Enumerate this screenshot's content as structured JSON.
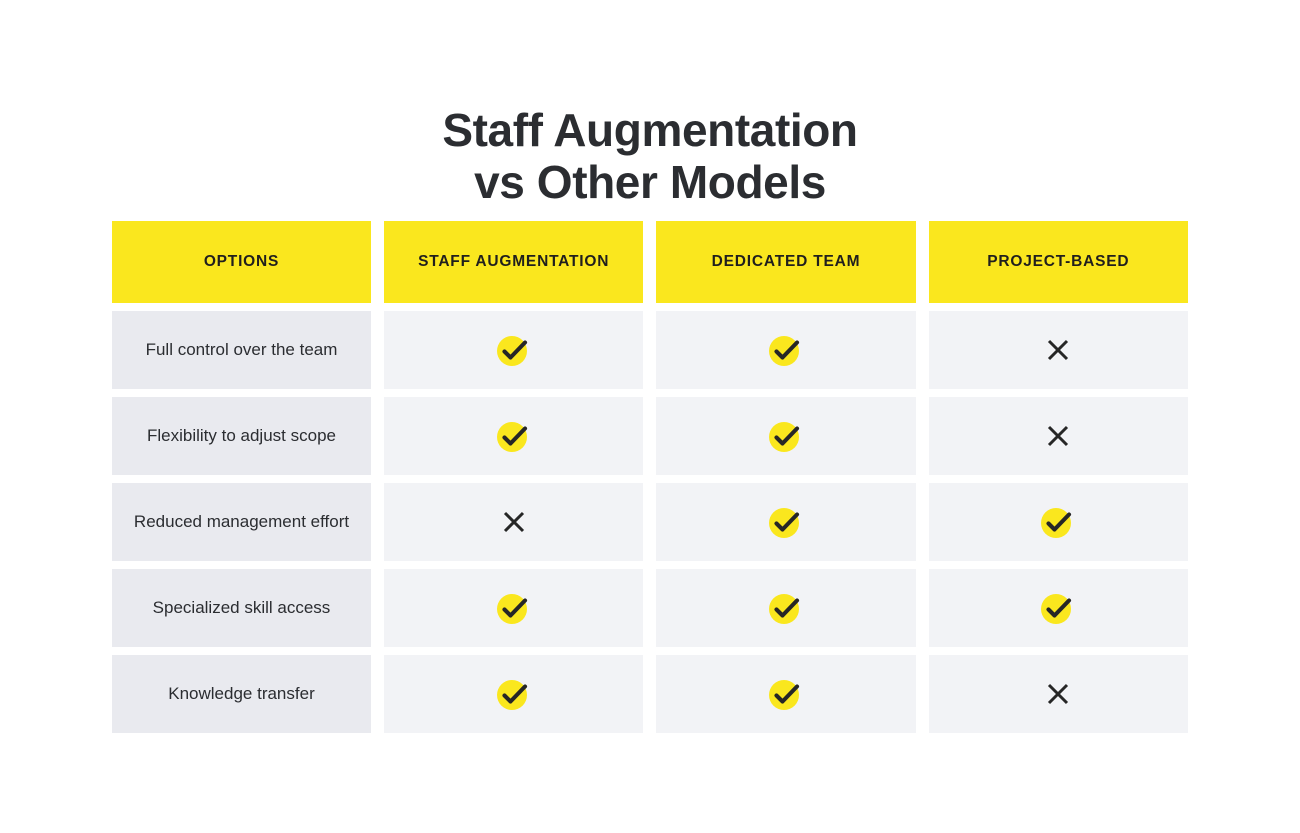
{
  "title": {
    "line1": "Staff Augmentation",
    "line2": "vs Other Models"
  },
  "colors": {
    "header_background": "#FAE71E",
    "header_text": "#201f1d",
    "label_cell_background": "#e9eaef",
    "data_cell_background": "#f2f3f6",
    "title_text": "#2b2d31",
    "check_circle": "#FAE71E",
    "check_stroke": "#262626",
    "cross_stroke": "#262626",
    "page_background": "#ffffff"
  },
  "table": {
    "columns": [
      {
        "label": "OPTIONS",
        "key": "options"
      },
      {
        "label": "STAFF AUGMENTATION",
        "key": "staff_augmentation"
      },
      {
        "label": "DEDICATED TEAM",
        "key": "dedicated_team"
      },
      {
        "label": "PROJECT-BASED",
        "key": "project_based"
      }
    ],
    "rows": [
      {
        "label": "Full control over the team",
        "values": [
          "check",
          "check",
          "cross"
        ]
      },
      {
        "label": "Flexibility to adjust scope",
        "values": [
          "check",
          "check",
          "cross"
        ]
      },
      {
        "label": "Reduced management effort",
        "values": [
          "cross",
          "check",
          "check"
        ]
      },
      {
        "label": "Specialized skill access",
        "values": [
          "check",
          "check",
          "check"
        ]
      },
      {
        "label": "Knowledge transfer",
        "values": [
          "check",
          "check",
          "cross"
        ]
      }
    ]
  },
  "icons": {
    "check": "check-circle-icon",
    "cross": "cross-icon"
  }
}
